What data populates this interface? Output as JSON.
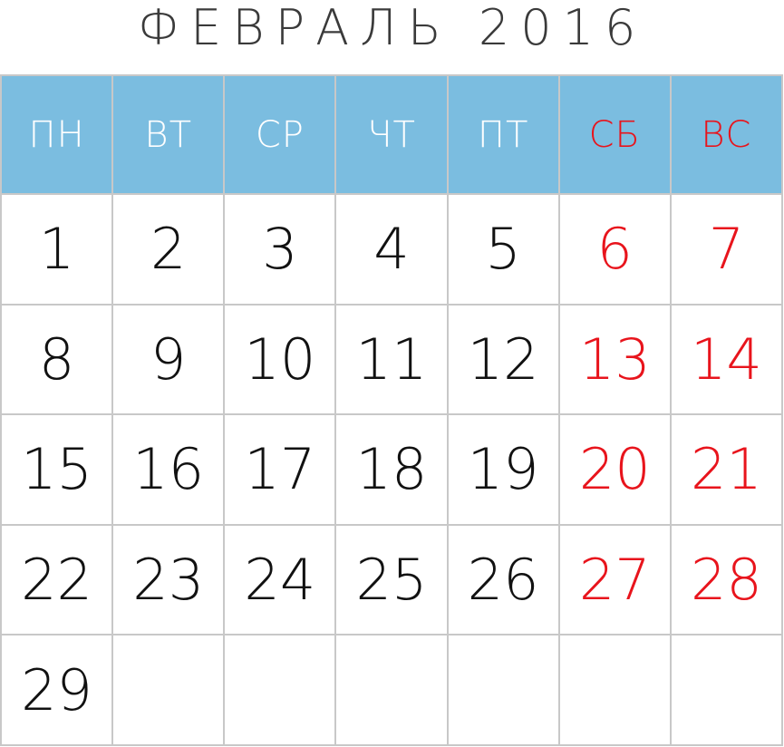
{
  "title": "ФЕВРАЛЬ 2016",
  "colors": {
    "header_bg": "#7bbde0",
    "weekday_text": "#ffffff",
    "weekend_text": "#e8141c",
    "day_text": "#111111",
    "grid_line": "#c8c8c8"
  },
  "weekdays": [
    {
      "label": "ПН",
      "weekend": false
    },
    {
      "label": "ВТ",
      "weekend": false
    },
    {
      "label": "СР",
      "weekend": false
    },
    {
      "label": "ЧТ",
      "weekend": false
    },
    {
      "label": "ПТ",
      "weekend": false
    },
    {
      "label": "СБ",
      "weekend": true
    },
    {
      "label": "ВС",
      "weekend": true
    }
  ],
  "weeks": [
    [
      "1",
      "2",
      "3",
      "4",
      "5",
      "6",
      "7"
    ],
    [
      "8",
      "9",
      "10",
      "11",
      "12",
      "13",
      "14"
    ],
    [
      "15",
      "16",
      "17",
      "18",
      "19",
      "20",
      "21"
    ],
    [
      "22",
      "23",
      "24",
      "25",
      "26",
      "27",
      "28"
    ],
    [
      "29",
      "",
      "",
      "",
      "",
      "",
      ""
    ]
  ]
}
